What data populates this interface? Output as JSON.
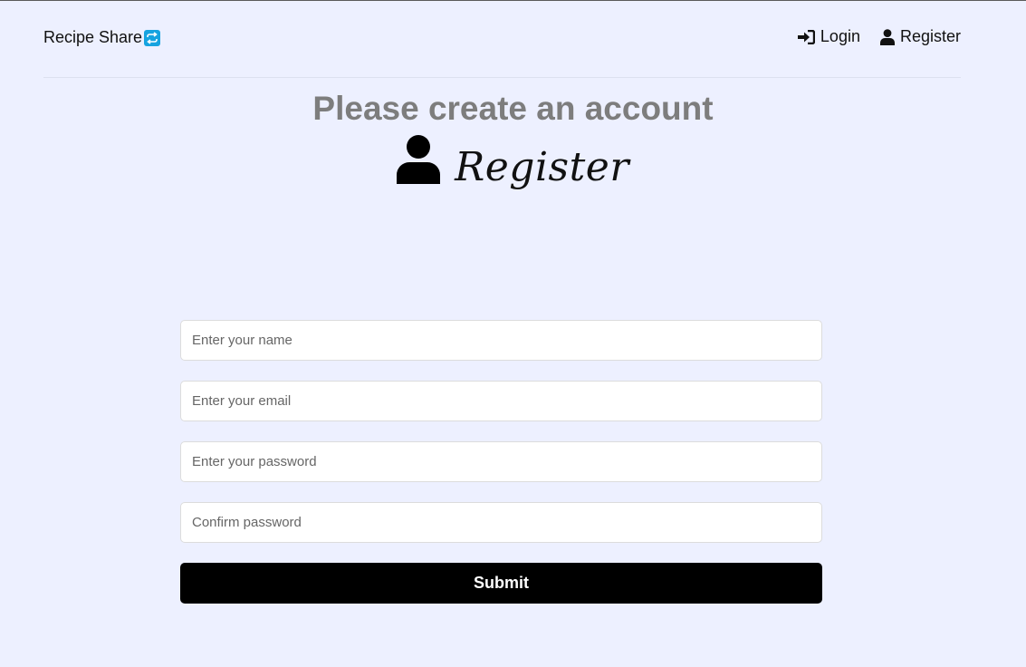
{
  "header": {
    "brand": "Recipe Share",
    "brand_icon": "repeat-icon",
    "nav": {
      "login_label": "Login",
      "login_icon": "sign-in-icon",
      "register_label": "Register",
      "register_icon": "user-icon"
    }
  },
  "hero": {
    "icon": "user-icon",
    "title": "Register",
    "subtitle": "Please create an account"
  },
  "form": {
    "name_placeholder": "Enter your name",
    "name_value": "",
    "email_placeholder": "Enter your email",
    "email_value": "",
    "password_placeholder": "Enter your password",
    "password_value": "",
    "confirm_placeholder": "Confirm password",
    "confirm_value": "",
    "submit_label": "Submit"
  },
  "colors": {
    "background": "#edf0ff",
    "subtitle": "#7d7d7d",
    "button": "#000000",
    "brand_icon_bg": "#16a3e0"
  }
}
